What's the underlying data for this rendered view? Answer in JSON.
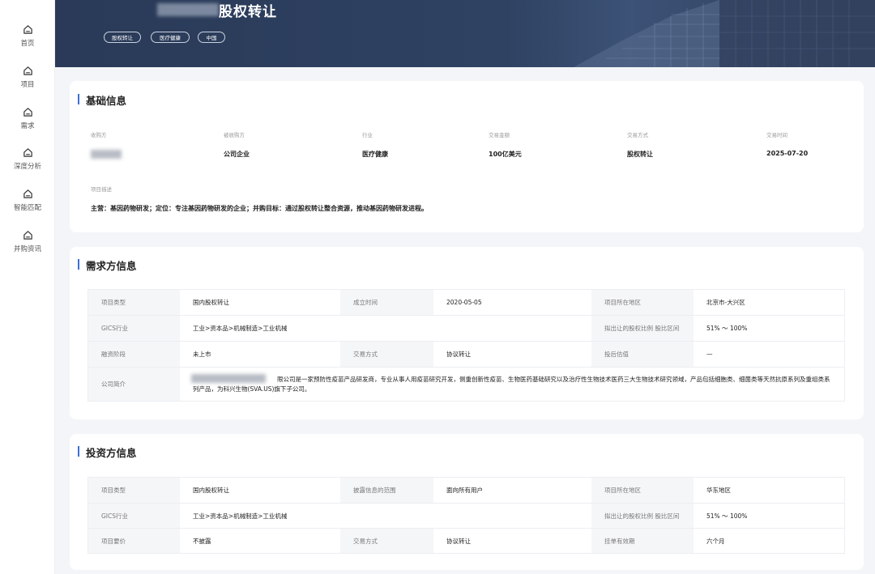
{
  "sidebar": {
    "items": [
      {
        "label": "首页",
        "icon": "home-icon"
      },
      {
        "label": "项目",
        "icon": "home-icon"
      },
      {
        "label": "需求",
        "icon": "home-icon"
      },
      {
        "label": "深度分析",
        "icon": "home-icon"
      },
      {
        "label": "智能匹配",
        "icon": "home-icon"
      },
      {
        "label": "并购资讯",
        "icon": "home-icon"
      }
    ]
  },
  "banner": {
    "title": "股权转让",
    "tags": [
      "股权转让",
      "医疗健康",
      "中国"
    ]
  },
  "basic_info": {
    "title": "基础信息",
    "fields": [
      {
        "label": "收购方",
        "value": ""
      },
      {
        "label": "被收购方",
        "value": "公司企业"
      },
      {
        "label": "行业",
        "value": "医疗健康"
      },
      {
        "label": "交易金额",
        "value": "100亿美元"
      },
      {
        "label": "交易方式",
        "value": "股权转让"
      },
      {
        "label": "交易时间",
        "value": "2025-07-20"
      }
    ],
    "desc_label": "项目描述",
    "desc_value": "主营：基因药物研发；定位：专注基因药物研发的企业；并购目标：通过股权转让整合资源，推动基因药物研发进程。"
  },
  "demand_info": {
    "title": "需求方信息",
    "rows": [
      {
        "cells": [
          {
            "label": "项目类型",
            "value": "国内股权转让"
          },
          {
            "label": "成立时间",
            "value": "2020-05-05"
          },
          {
            "label": "项目所在地区",
            "value": "北京市-大兴区"
          }
        ]
      },
      {
        "cells": [
          {
            "label": "GICS行业",
            "value": "工业>资本品>机械制造>工业机械"
          },
          {
            "label": "",
            "value": ""
          },
          {
            "label": "拟出让的股权比例 股比区间",
            "value": "51% ～ 100%"
          }
        ]
      },
      {
        "cells": [
          {
            "label": "融资阶段",
            "value": "未上市"
          },
          {
            "label": "交易方式",
            "value": "协议转让"
          },
          {
            "label": "投后估值",
            "value": "—"
          }
        ]
      }
    ],
    "profile_label": "公司简介",
    "profile_value": "限公司是一家预防性疫苗产品研发商，专业从事人用疫苗研究开发，侧重创新性疫苗、生物医药基础研究以及治疗性生物技术医药三大生物技术研究领域，产品包括细胞类、细菌类等天然抗原系列及重组类系列产品，为科兴生物(SVA.US)旗下子公司。"
  },
  "investor_info": {
    "title": "投资方信息",
    "rows": [
      {
        "cells": [
          {
            "label": "项目类型",
            "value": "国内股权转让"
          },
          {
            "label": "披露信息的范围",
            "value": "面向所有用户"
          },
          {
            "label": "项目所在地区",
            "value": "华东地区"
          }
        ]
      },
      {
        "cells": [
          {
            "label": "GICS行业",
            "value": "工业>资本品>机械制造>工业机械"
          },
          {
            "label": "",
            "value": ""
          },
          {
            "label": "拟出让的股权比例 股比区间",
            "value": "51% ～ 100%"
          }
        ]
      },
      {
        "cells": [
          {
            "label": "项目要价",
            "value": "不披露"
          },
          {
            "label": "交易方式",
            "value": "协议转让"
          },
          {
            "label": "挂单有效期",
            "value": "六个月"
          }
        ]
      }
    ]
  },
  "colors": {
    "accent": "#3d6fd8",
    "banner": "#2f4262",
    "page_bg": "#f4f5f8"
  }
}
